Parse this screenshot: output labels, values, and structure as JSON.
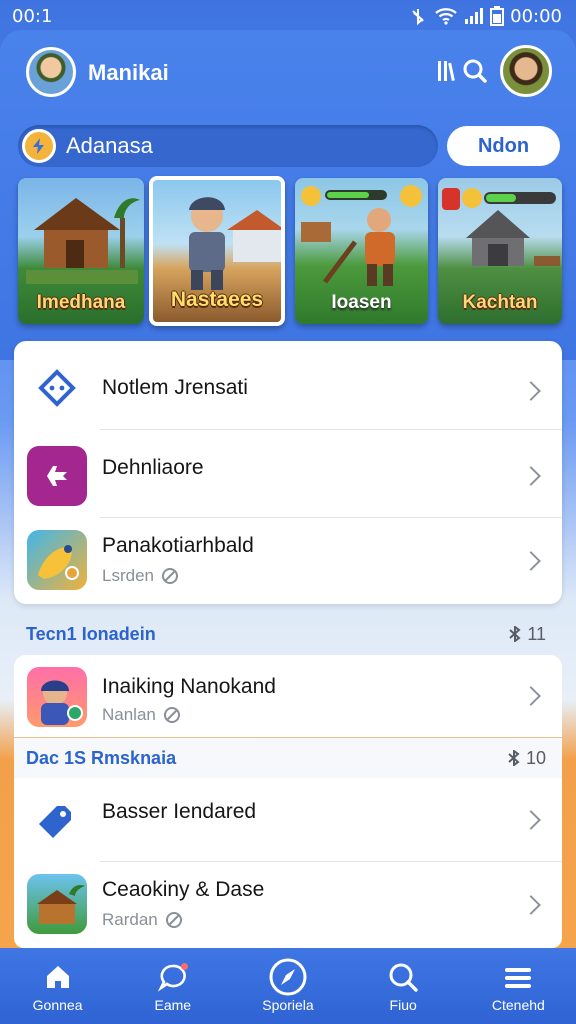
{
  "status_bar": {
    "time": "00:1",
    "clock": "00:00"
  },
  "header": {
    "brand": "Manikai"
  },
  "search": {
    "label": "Adanasa",
    "button": "Ndon"
  },
  "cards": [
    {
      "caption": "Imedhana"
    },
    {
      "caption": "Nastaees"
    },
    {
      "caption": "Ioasen"
    },
    {
      "caption": "Kachtan"
    }
  ],
  "list": [
    {
      "title": "Notlem Jrensati"
    },
    {
      "title": "Dehnliaore"
    },
    {
      "title": "Panakotiarhbald",
      "sub": "Lsrden"
    }
  ],
  "section1": {
    "title": "Tecn1 Ionadein",
    "count": "11"
  },
  "section1_items": [
    {
      "title": "Inaiking Nanokand",
      "sub": "Nanlan"
    }
  ],
  "section2": {
    "title": "Dac 1S Rmsknaia",
    "count": "10"
  },
  "section2_items": [
    {
      "title": "Basser Iendared"
    },
    {
      "title": "Ceaokiny & Dase",
      "sub": "Rardan"
    }
  ],
  "nav": [
    {
      "label": "Gonnea",
      "icon": "home-icon"
    },
    {
      "label": "Eame",
      "icon": "chat-icon"
    },
    {
      "label": "Sporiela",
      "icon": "compass-icon"
    },
    {
      "label": "Fiuo",
      "icon": "search-icon"
    },
    {
      "label": "Ctenehd",
      "icon": "menu-icon"
    }
  ],
  "colors": {
    "primary": "#3f75e2",
    "accent": "#f4b33a",
    "purple": "#a3278e",
    "text": "#161616",
    "muted": "#8a8f98"
  }
}
